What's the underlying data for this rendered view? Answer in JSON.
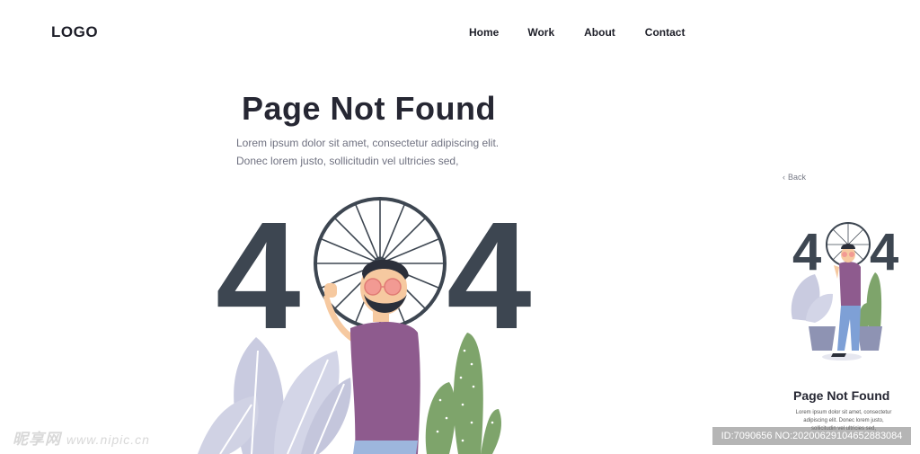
{
  "header": {
    "logo": "LOGO",
    "nav": [
      {
        "label": "Home"
      },
      {
        "label": "Work"
      },
      {
        "label": "About"
      },
      {
        "label": "Contact"
      }
    ]
  },
  "main": {
    "title": "Page Not Found",
    "description": "Lorem ipsum dolor sit amet, consectetur  adipiscing elit. Donec lorem justo, sollicitudin vel ultricies sed,",
    "error_digit_left": "4",
    "error_digit_right": "4"
  },
  "mobile_preview": {
    "back_label": "Back",
    "error_digit_left": "4",
    "error_digit_right": "4",
    "title": "Page Not Found",
    "description": "Lorem ipsum dolor sit amet, consectetur adipiscing elit. Donec lorem justo, sollicitudin vel ultricies sed,"
  },
  "watermark": {
    "left": "昵享网",
    "left_url": "www.nipic.cn",
    "right": "ID:7090656 NO:20200629104652883084"
  },
  "colors": {
    "digit": "#3d4651",
    "shirt": "#8e5b8e",
    "cactus": "#7ea46b",
    "leaves": "#c9cbe0",
    "skin": "#f6c9a0",
    "glasses": "#f29a93",
    "pot": "#8e93b3"
  }
}
